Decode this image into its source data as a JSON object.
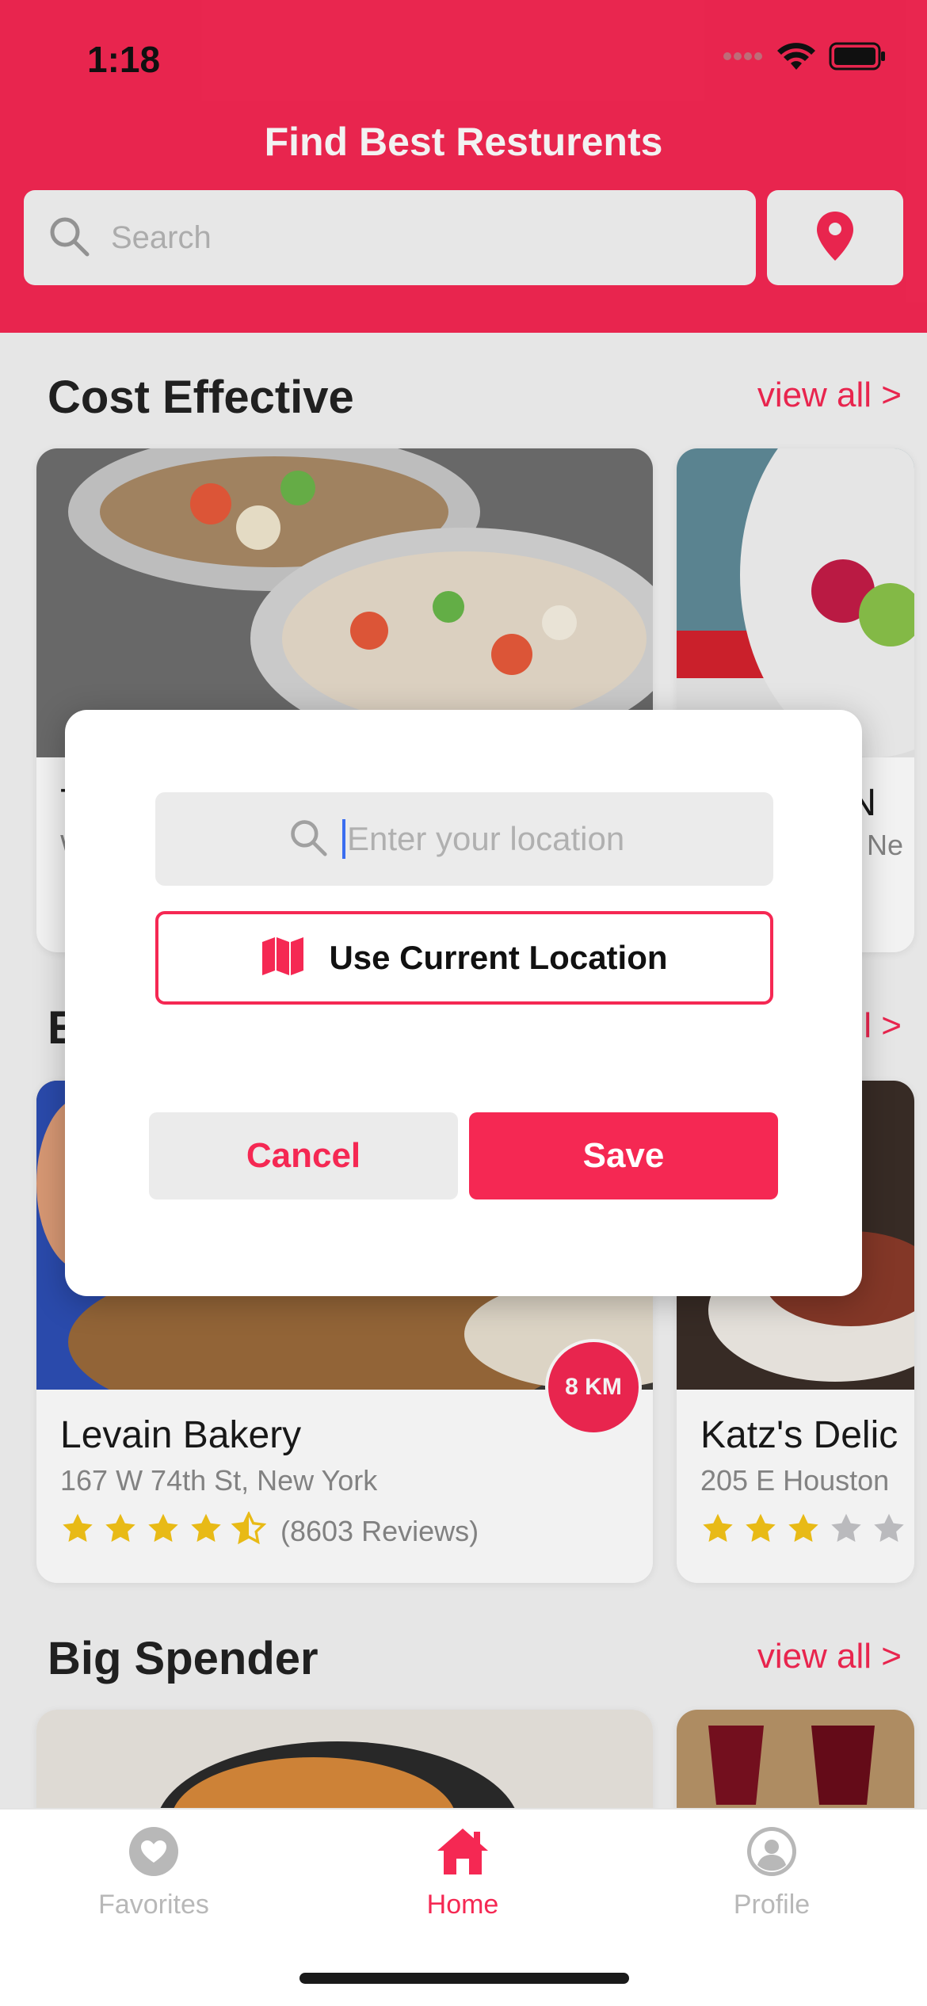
{
  "status_bar": {
    "time": "1:18"
  },
  "header": {
    "title": "Find Best Resturents",
    "search_placeholder": "Search"
  },
  "sections": [
    {
      "title": "Cost Effective",
      "view_all": "view all >"
    },
    {
      "title": "E",
      "view_all": "l >"
    },
    {
      "title": "Big Spender",
      "view_all": "view all >"
    }
  ],
  "cost_cards": [
    {
      "name": "T",
      "addr": "W"
    },
    {
      "name": "s N",
      "addr": "Ne"
    }
  ],
  "featured_cards": [
    {
      "name": "Levain Bakery",
      "address": "167 W 74th St, New York",
      "distance": "8 KM",
      "rating": 4.5,
      "reviews": "(8603 Reviews)"
    },
    {
      "name": "Katz's Delic",
      "address": "205 E Houston",
      "rating": 3
    }
  ],
  "dialog": {
    "location_placeholder": "Enter your location",
    "use_current_label": "Use Current Location",
    "cancel_label": "Cancel",
    "save_label": "Save"
  },
  "tabbar": {
    "items": [
      {
        "label": "Favorites",
        "icon": "heart-icon",
        "active": false
      },
      {
        "label": "Home",
        "icon": "home-icon",
        "active": true
      },
      {
        "label": "Profile",
        "icon": "user-icon",
        "active": false
      }
    ]
  },
  "colors": {
    "accent": "#f52853",
    "star": "#f5c518",
    "inactive": "#b8b8b8"
  }
}
